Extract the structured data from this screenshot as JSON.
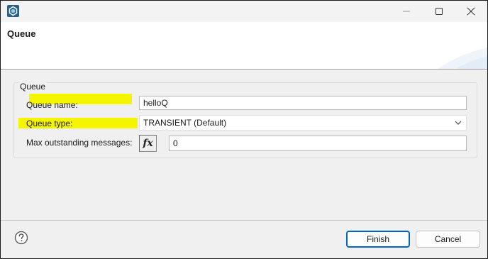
{
  "window": {
    "controls": {
      "minimize": "–",
      "maximize": "☐",
      "close": "✕"
    }
  },
  "header": {
    "title": "Queue"
  },
  "group": {
    "title": "Queue",
    "fields": {
      "queue_name": {
        "label": "Queue name:",
        "value": "helloQ"
      },
      "queue_type": {
        "label": "Queue type:",
        "value": "TRANSIENT (Default)"
      },
      "max_outstanding": {
        "label": "Max outstanding messages:",
        "value": "0",
        "fx_label": "fx"
      }
    }
  },
  "footer": {
    "finish_label": "Finish",
    "cancel_label": "Cancel"
  },
  "colors": {
    "highlight": "#f5f500",
    "default_button_border": "#0067c0"
  },
  "icons": {
    "app": "app-logo-icon",
    "help": "help-icon",
    "chevron": "chevron-down-icon"
  }
}
